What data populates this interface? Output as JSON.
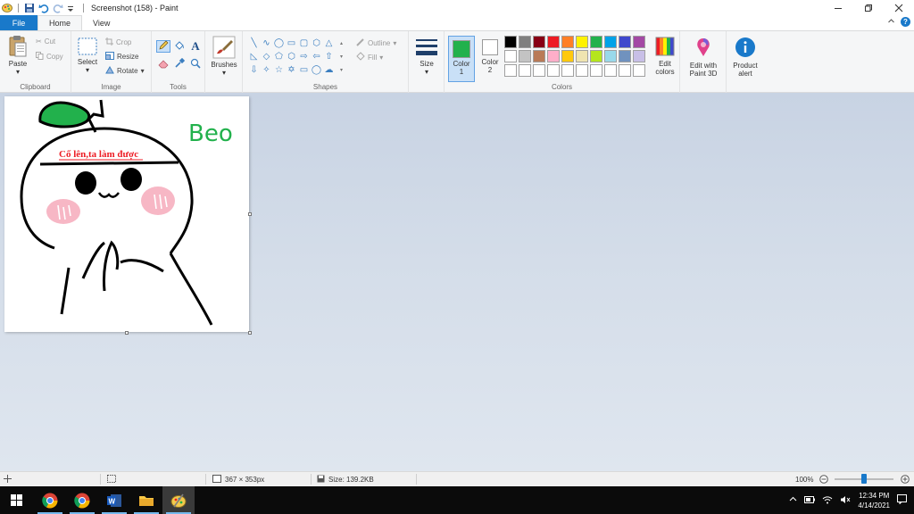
{
  "window": {
    "title": "Screenshot (158) - Paint"
  },
  "tabs": {
    "file": "File",
    "home": "Home",
    "view": "View"
  },
  "clipboard": {
    "label": "Clipboard",
    "paste": "Paste",
    "cut": "Cut",
    "copy": "Copy"
  },
  "image": {
    "label": "Image",
    "select": "Select",
    "crop": "Crop",
    "resize": "Resize",
    "rotate": "Rotate"
  },
  "tools": {
    "label": "Tools"
  },
  "brushes": {
    "label": "Brushes"
  },
  "shapes": {
    "label": "Shapes",
    "outline": "Outline",
    "fill": "Fill"
  },
  "size": {
    "label": "Size"
  },
  "colors": {
    "label": "Colors",
    "color1": "Color",
    "color1_num": "1",
    "color2": "Color",
    "color2_num": "2",
    "color1_value": "#22b14c",
    "color2_value": "#ffffff",
    "edit_colors_1": "Edit",
    "edit_colors_2": "colors",
    "palette_row1": [
      "#000000",
      "#7f7f7f",
      "#880015",
      "#ed1c24",
      "#ff7f27",
      "#fff200",
      "#22b14c",
      "#00a2e8",
      "#3f48cc",
      "#a349a4"
    ],
    "palette_row2": [
      "#ffffff",
      "#c3c3c3",
      "#b97a57",
      "#ffaec9",
      "#ffc90e",
      "#efe4b0",
      "#b5e61d",
      "#99d9ea",
      "#7092be",
      "#c8bfe7"
    ]
  },
  "paint3d": {
    "line1": "Edit with",
    "line2": "Paint 3D"
  },
  "product_alert": {
    "line1": "Product",
    "line2": "alert"
  },
  "drawing": {
    "banner_text": "Cố lên,ta làm được",
    "signature": "Beo"
  },
  "status": {
    "dimensions": "367 × 353px",
    "size": "Size: 139.2KB",
    "zoom": "100%"
  },
  "zoom_level": 1.0,
  "taskbar": {
    "time": "12:34 PM",
    "date": "4/14/2021"
  }
}
